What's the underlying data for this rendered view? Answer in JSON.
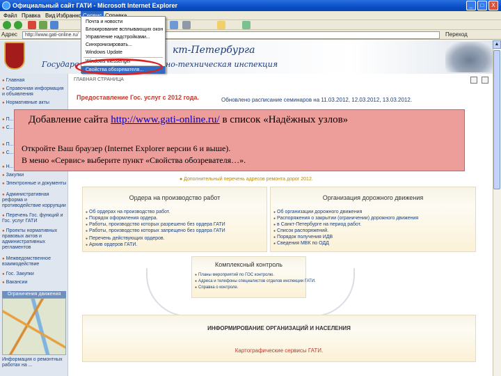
{
  "window": {
    "title": "Официальный сайт ГАТИ - Microsoft Internet Explorer",
    "controls": [
      "_",
      "□",
      "X"
    ]
  },
  "menubar": {
    "items": [
      "Файл",
      "Правка",
      "Вид",
      "Избранное",
      "Сервис",
      "Справка"
    ]
  },
  "addressbar": {
    "label": "Адрес",
    "value": "http://www.gati-online.ru/",
    "go": "Переход"
  },
  "dropdown": {
    "items": [
      "Почта и новости",
      "Блокирование всплывающих окон",
      "Управление надстройками...",
      "Синхронизировать...",
      "Windows Update",
      "Windows Messenger",
      "Свойства обозревателя..."
    ],
    "selected": "Свойства обозревателя..."
  },
  "header": {
    "line1": "кт-Петербурга",
    "line2a": "Государс",
    "line2b": "но-техническая инспекция"
  },
  "sidebar": {
    "items": [
      "Главная",
      "Справочная информация и объявления",
      "Нормативные акты",
      "П...",
      "С...",
      "П...",
      "С...",
      "Н...",
      "Закупки",
      "Электронные и документы",
      "Административная реформа и противодействие коррупции",
      "Перечень Гос. функций и Гос. услуг ГАТИ",
      "Проекты нормативных правовых актов и административных регламентов",
      "Межведомственное взаимодействие",
      "Гос. Закупки",
      "Вакансии"
    ],
    "map_title": "Ограничения движения",
    "info_text": "Информация о ремонтных работах на ..."
  },
  "main": {
    "crumbs": "ГЛАВНАЯ СТРАНИЦА",
    "services_2012": "Предоставление Гос. услуг с 2012 года.",
    "seminars": "Обновлено расписание семинаров на 11.03.2012, 12.03.2012, 13.03.2012.",
    "extra_roads": "● Дополнительный перечень адресов ремонта дорог 2012.",
    "orders": {
      "title": "Ордера на производство работ",
      "items": [
        "Об ордерах на производство работ.",
        "Порядок оформления ордера.",
        "Работы, производство которых разрешено без ордера ГАТИ",
        "Работы, производство которых запрещено без ордера ГАТИ",
        "Перечень действующих ордеров.",
        "Архив ордеров ГАТИ."
      ]
    },
    "traffic": {
      "title": "Организация дорожного движения",
      "items": [
        "Об организации дорожного движения",
        "Распоряжения о закрытии (ограничении) дорожного движения",
        "в Санкт-Петербурге на период работ.",
        "Список распоряжений.",
        "Порядок получения ИДВ",
        "Сведения МВК по ОДД"
      ]
    },
    "control": {
      "title": "Комплексный контроль",
      "items": [
        "Планы мероприятий по ГОС контролю.",
        "Адреса и телефоны специалистов отделов инспекции ГАТИ.",
        "Справка о контроле."
      ]
    },
    "inform": {
      "title": "ИНФОРМИРОВАНИЕ ОРГАНИЗАЦИЙ И НАСЕЛЕНИЯ",
      "link": "Картографические сервисы ГАТИ."
    }
  },
  "overlay": {
    "title_prefix": "Добавление сайта ",
    "title_link": "http://www.gati-online.ru/",
    "title_suffix": " в список «Надёжных узлов»",
    "line1": "Откройте Ваш браузер (Internet Explorer версии 6 и выше).",
    "line2": "В меню «Сервис» выберите пункт «Свойства обозревателя…»."
  },
  "colors": {
    "titlebar": "#0a4fc8",
    "overlay_bg": "#ee9e9a",
    "highlight": "#d92323",
    "accent_red": "#c0392b",
    "link_blue": "#1b3f7a"
  }
}
